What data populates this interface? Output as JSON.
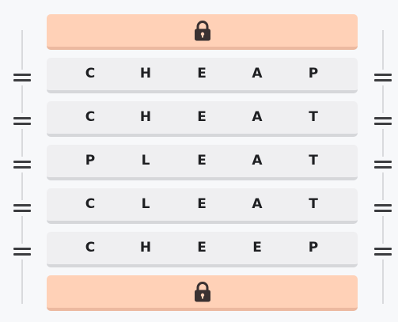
{
  "top_lock": {
    "icon": "lock-icon",
    "color": "#ffd1b7"
  },
  "bottom_lock": {
    "icon": "lock-icon",
    "color": "#ffd1b7"
  },
  "rows": [
    {
      "letters": [
        "C",
        "H",
        "E",
        "A",
        "P"
      ]
    },
    {
      "letters": [
        "C",
        "H",
        "E",
        "A",
        "T"
      ]
    },
    {
      "letters": [
        "P",
        "L",
        "E",
        "A",
        "T"
      ]
    },
    {
      "letters": [
        "C",
        "L",
        "E",
        "A",
        "T"
      ]
    },
    {
      "letters": [
        "C",
        "H",
        "E",
        "E",
        "P"
      ]
    }
  ],
  "handle_icon": "drag-handle-icon",
  "row_color": "#efeff1"
}
